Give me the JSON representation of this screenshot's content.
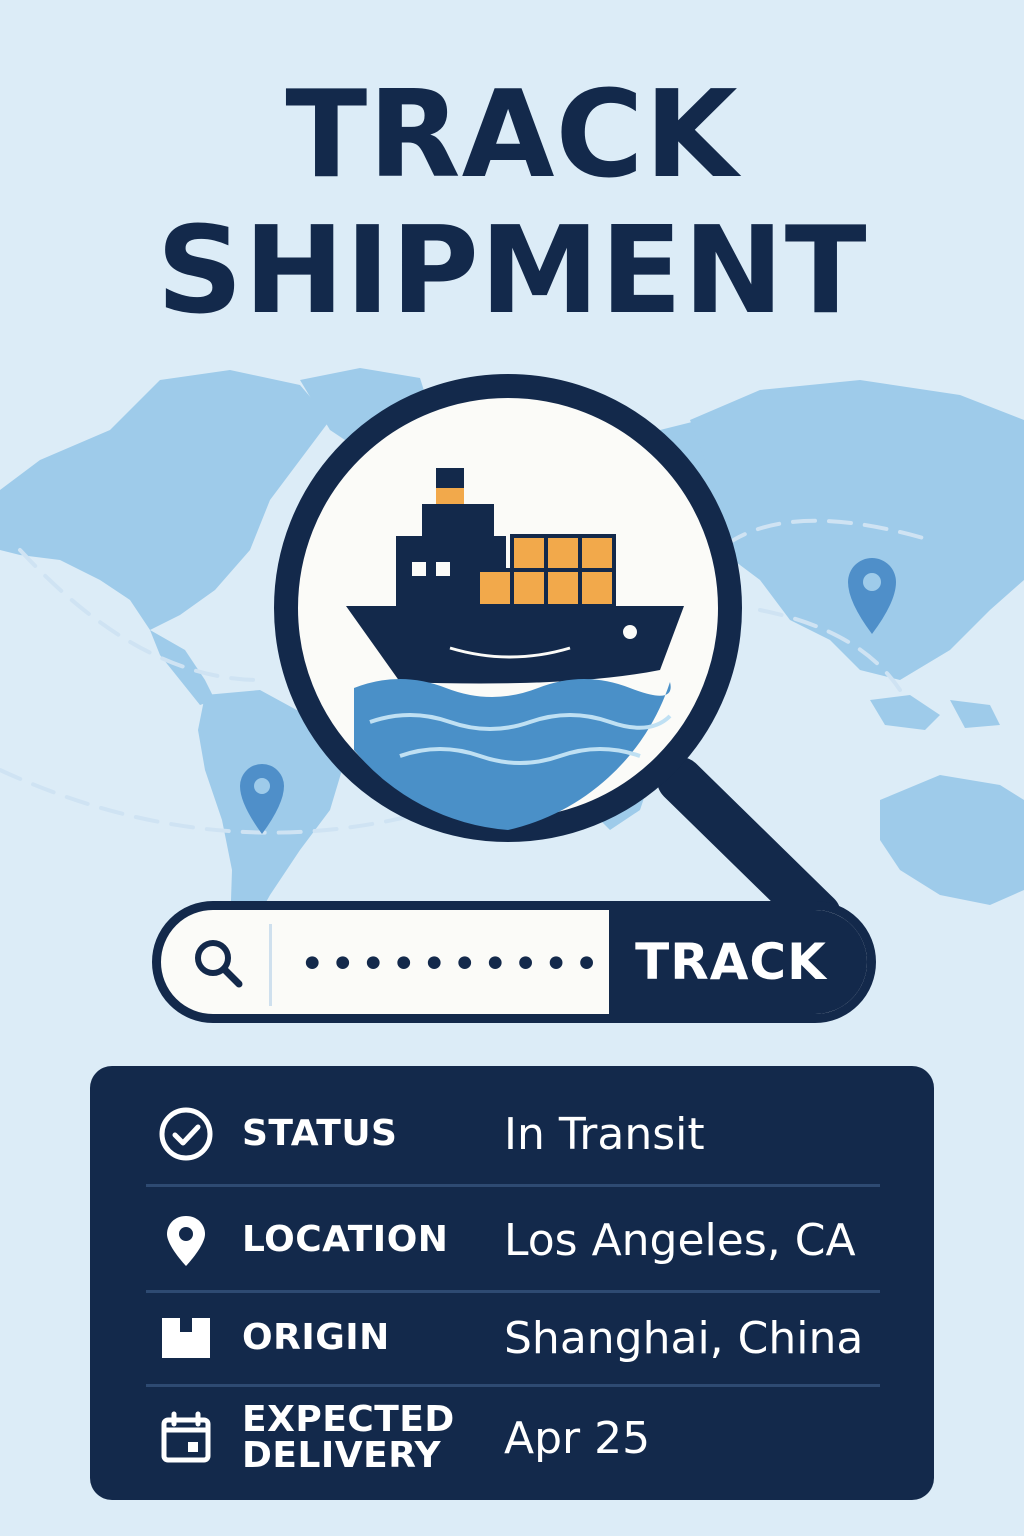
{
  "header": {
    "title_line_1": "TRACK",
    "title_line_2": "SHIPMENT"
  },
  "search": {
    "icon": "search-icon",
    "value": "••••••••••",
    "button_label": "TRACK"
  },
  "shipment": {
    "rows": [
      {
        "icon": "check-circle-icon",
        "label": "STATUS",
        "value": "In Transit"
      },
      {
        "icon": "map-pin-icon",
        "label": "LOCATION",
        "value": "Los Angeles, CA"
      },
      {
        "icon": "package-icon",
        "label": "ORIGIN",
        "value": "Shanghai, China"
      },
      {
        "icon": "calendar-icon",
        "label": "EXPECTED DELIVERY",
        "value": "Apr 25"
      }
    ]
  },
  "illustration": {
    "icons": [
      "world-map",
      "magnifier-icon",
      "cargo-ship-icon",
      "map-pin-icon"
    ]
  },
  "colors": {
    "background": "#dcecf7",
    "navy": "#13294b",
    "map_blue": "#9ecbea",
    "pin_blue": "#4f8fc9",
    "container_orange": "#f2a94b",
    "water_blue": "#4a90c8",
    "panel_text": "#ffffff"
  }
}
